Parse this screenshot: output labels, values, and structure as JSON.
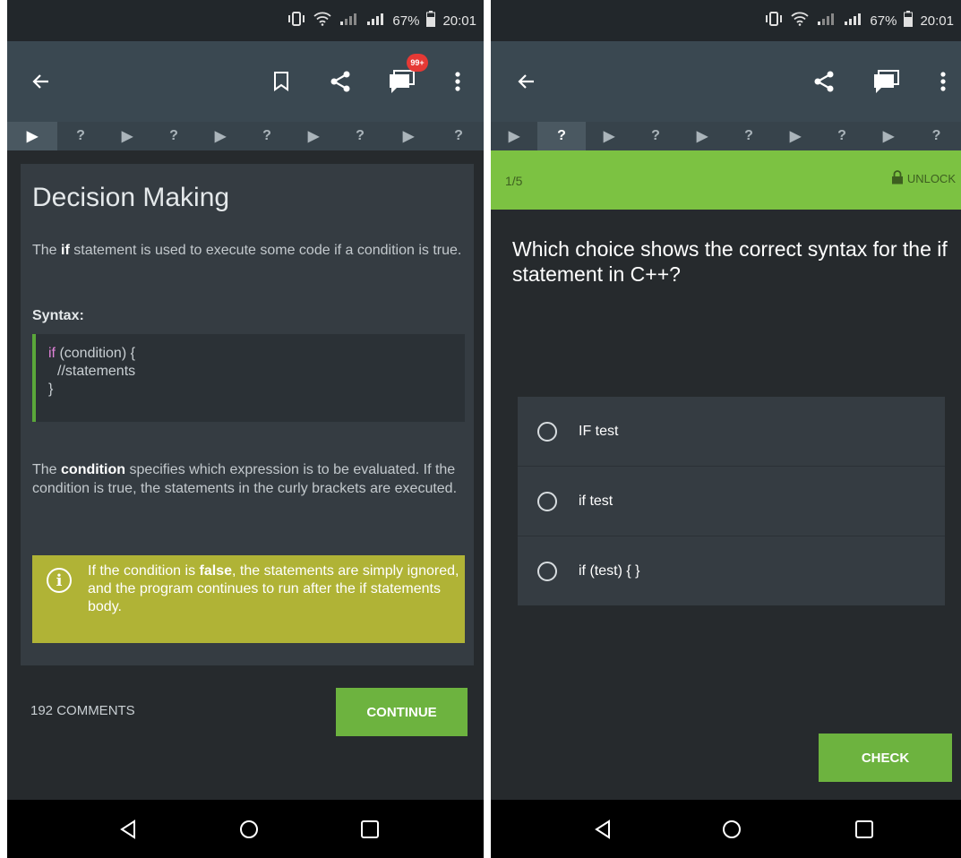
{
  "status_bar": {
    "battery": "67%",
    "time": "20:01"
  },
  "toolbar_left": {
    "notifications_badge": "99+"
  },
  "progress_steps": [
    "▶",
    "?",
    "▶",
    "?",
    "▶",
    "?",
    "▶",
    "?",
    "▶",
    "?"
  ],
  "lesson": {
    "title": "Decision Making",
    "intro_pre": "The ",
    "intro_bold": "if",
    "intro_post": " statement is used to execute some code if a condition is true.",
    "syntax_label": "Syntax:",
    "code_keyword": "if",
    "code_line1_rest": " (condition) {",
    "code_line2": "//statements",
    "code_line3": "}",
    "explain_pre": "The ",
    "explain_bold": "condition",
    "explain_post": " specifies which expression is to be evaluated. If the condition is true, the statements in the curly brackets are executed.",
    "note_pre": "If the condition is ",
    "note_bold": "false",
    "note_post": ", the statements are simply ignored, and the program continues to run after the if statements body.",
    "comments_label": "192 COMMENTS",
    "continue_label": "CONTINUE"
  },
  "quiz": {
    "counter": "1/5",
    "unlock_label": "UNLOCK",
    "question": "Which choice shows the correct syntax for the if statement in C++?",
    "options": [
      "IF test",
      "if test",
      "if (test) { }"
    ],
    "check_label": "CHECK"
  },
  "colors": {
    "accent_green": "#6db33f",
    "quiz_header": "#7cc242",
    "note_yellow": "#b0b336",
    "toolbar": "#3a4851"
  }
}
